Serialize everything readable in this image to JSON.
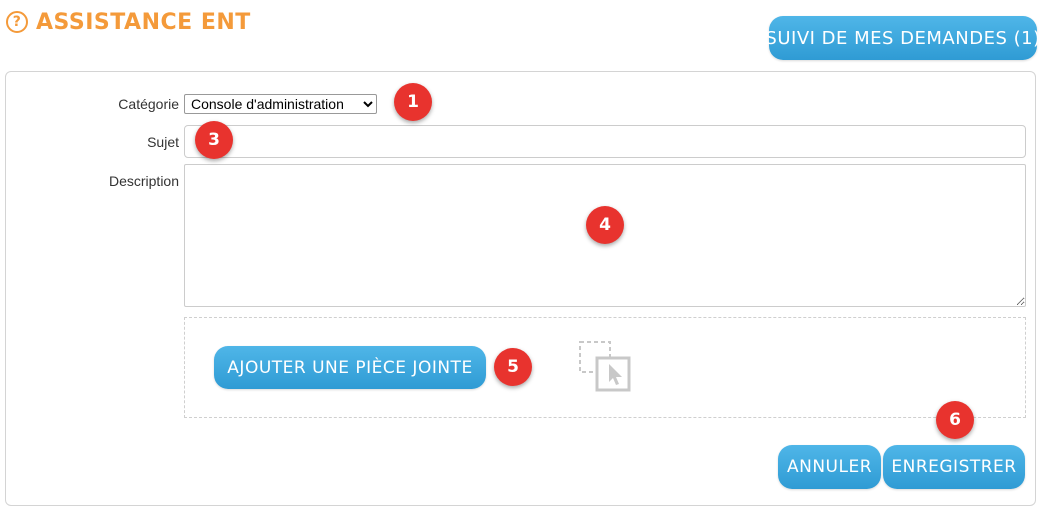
{
  "header": {
    "title": "ASSISTANCE ENT",
    "help_icon": "question-circle-icon",
    "track_button": "SUIVI DE MES DEMANDES (1)"
  },
  "form": {
    "category_label": "Catégorie",
    "category_value": "Console d'administration",
    "subject_label": "Sujet",
    "subject_value": "",
    "description_label": "Description",
    "description_value": "",
    "attach_button": "AJOUTER UNE PIÈCE JOINTE",
    "drop_icon": "drag-drop-file-icon",
    "cancel_button": "ANNULER",
    "save_button": "ENREGISTRER"
  },
  "markers": [
    "1",
    "3",
    "4",
    "5",
    "6"
  ],
  "colors": {
    "title": "#f49a3a",
    "button": "#3aa5dd",
    "marker": "#e8332e"
  }
}
